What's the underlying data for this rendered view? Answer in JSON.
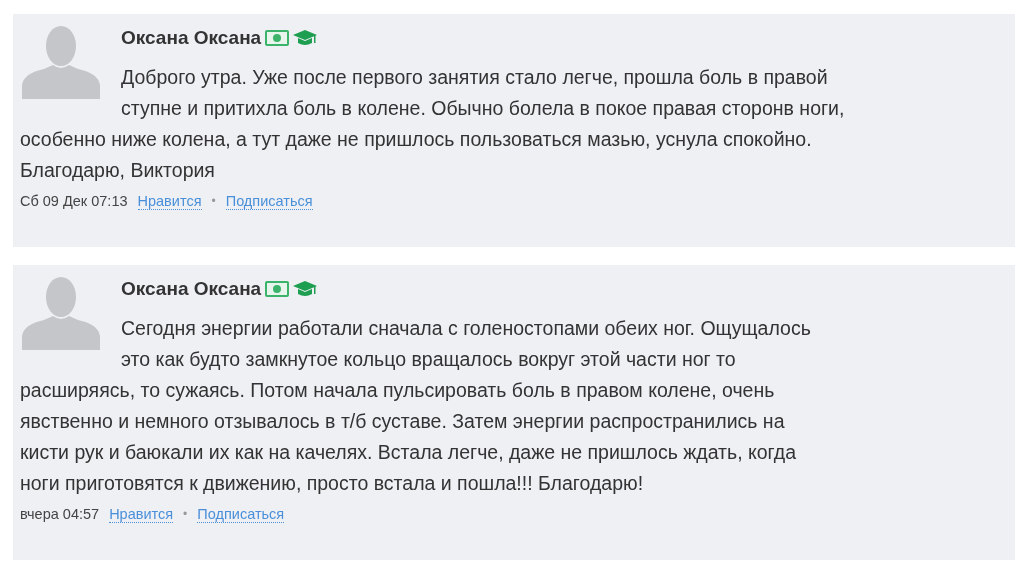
{
  "comments": [
    {
      "author": "Оксана Оксана",
      "text_lines": [
        "Доброго утра. Уже после первого занятия стало легче, прошла боль в правой",
        "ступне и притихла боль в колене. Обычно болела в покое правая сторонв ноги,",
        "особенно ниже колена, а тут даже не пришлось пользоваться мазью, уснула спокойно.",
        "Благодарю, Виктория"
      ],
      "date": "Сб 09 Дек 07:13",
      "like": "Нравится",
      "separator": "•",
      "subscribe": "Подписаться"
    },
    {
      "author": "Оксана Оксана",
      "text_lines": [
        "Сегодня энергии работали сначала с голеностопами обеих ног. Ощущалось",
        "это как будто замкнутое кольцо вращалось вокруг этой части ног то",
        "расширяясь, то сужаясь. Потом начала пульсировать боль в правом колене, очень",
        "явственно и немного отзывалось в т/б суставе. Затем энергии распространились на",
        "кисти рук и баюкали их как на качелях. Встала легче, даже не пришлось ждать, когда",
        "ноги приготовятся к движению, просто встала и пошла!!! Благодарю!"
      ],
      "date": "вчера 04:57",
      "like": "Нравится",
      "separator": "•",
      "subscribe": "Подписаться"
    }
  ]
}
